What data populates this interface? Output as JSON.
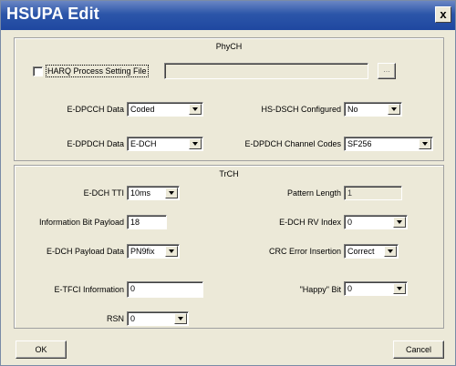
{
  "window": {
    "title": "HSUPA Edit",
    "close_glyph": "x"
  },
  "phych": {
    "title": "PhyCH",
    "harq_label": "HARQ Process Setting File",
    "harq_value": "",
    "browse_label": "...",
    "edpcch_label": "E-DPCCH Data",
    "edpcch_value": "Coded",
    "hsdsch_label": "HS-DSCH Configured",
    "hsdsch_value": "No",
    "edpdch_label": "E-DPDCH Data",
    "edpdch_value": "E-DCH",
    "codes_label": "E-DPDCH Channel Codes",
    "codes_value": "SF256"
  },
  "trch": {
    "title": "TrCH",
    "tti_label": "E-DCH TTI",
    "tti_value": "10ms",
    "pattern_label": "Pattern Length",
    "pattern_value": "1",
    "info_label": "Information Bit Payload",
    "info_value": "18",
    "rv_label": "E-DCH RV Index",
    "rv_value": "0",
    "payload_label": "E-DCH Payload Data",
    "payload_value": "PN9fix",
    "crc_label": "CRC Error Insertion",
    "crc_value": "Correct",
    "etfci_label": "E-TFCI Information",
    "etfci_value": "0",
    "happy_label": "\"Happy\" Bit",
    "happy_value": "0",
    "rsn_label": "RSN",
    "rsn_value": "0"
  },
  "buttons": {
    "ok": "OK",
    "cancel": "Cancel"
  }
}
